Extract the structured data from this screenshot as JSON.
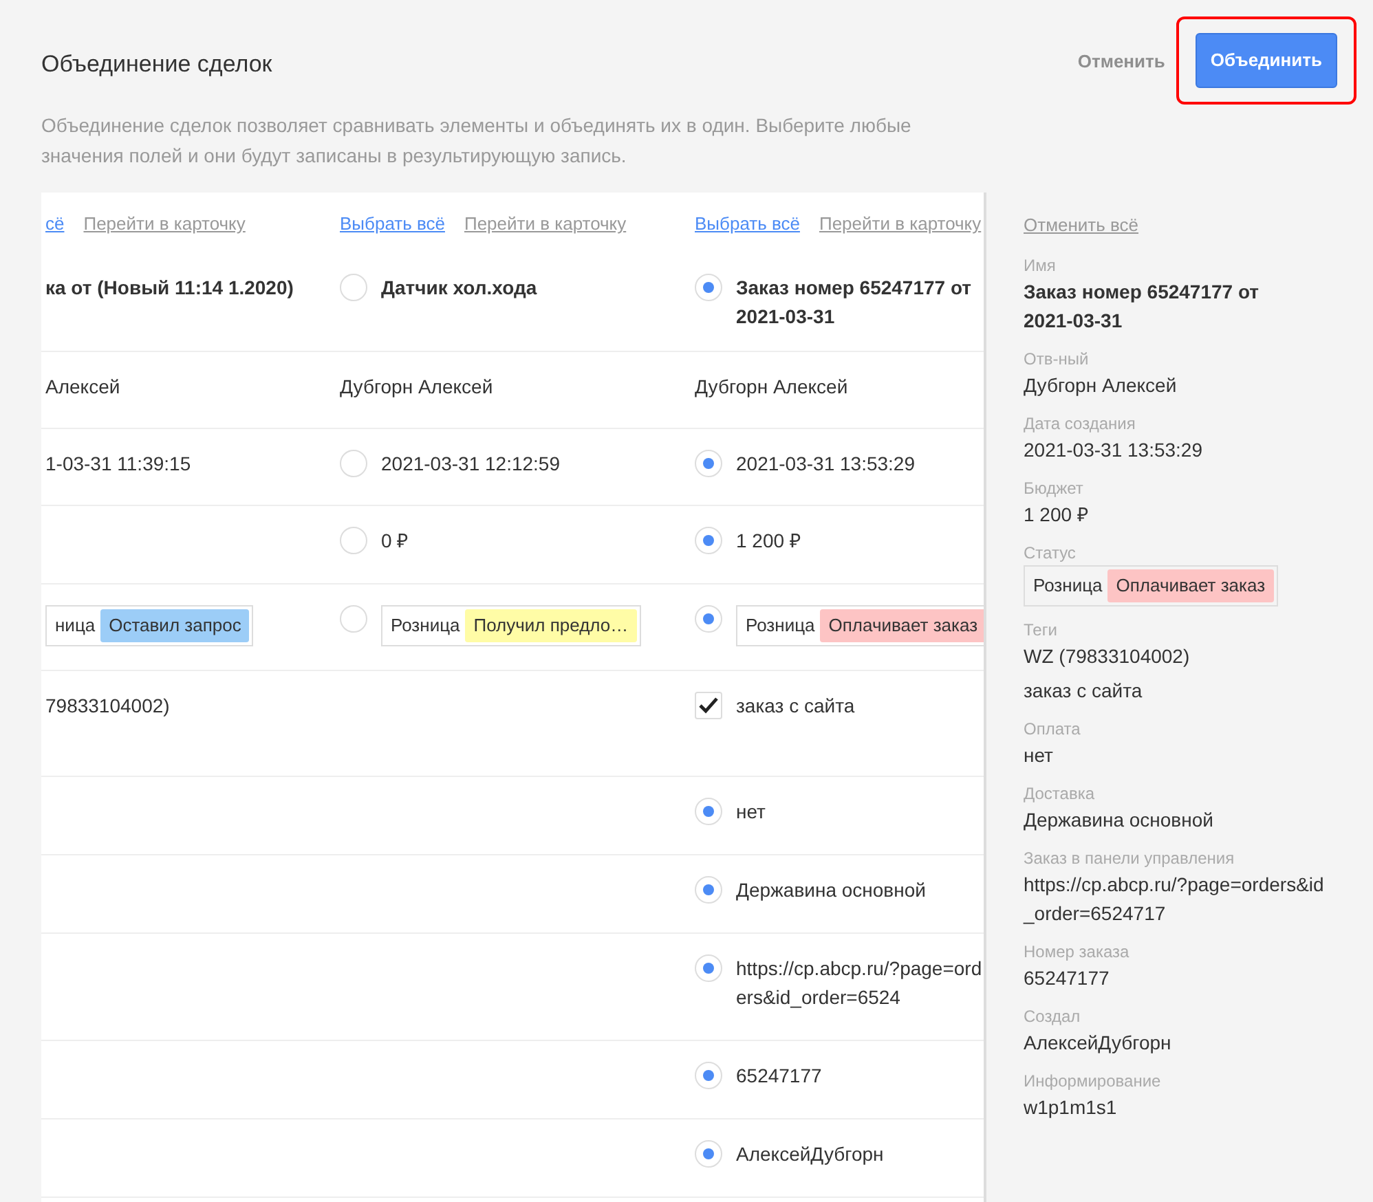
{
  "header": {
    "title": "Объединение сделок",
    "description": "Объединение сделок позволяет сравнивать элементы и объединять их в один. Выберите любые значения полей и они будут записаны в результирующую запись.",
    "cancel_button": "Отменить",
    "merge_button": "Объединить",
    "merge_highlighted": true
  },
  "columns": [
    {
      "select_all": "сё",
      "open_card": "Перейти в карточку",
      "cells": [
        {
          "kind": "title",
          "text": "ка от (Новый 11:14 1.2020)"
        },
        {
          "kind": "plain",
          "text": "Алексей"
        },
        {
          "kind": "plain",
          "text": "1-03-31 11:39:15"
        },
        {
          "kind": "empty"
        },
        {
          "kind": "status",
          "pipeline": "ница",
          "stage": "Оставил запрос",
          "color": "#9ccdf7"
        },
        {
          "kind": "plain",
          "text": "79833104002)"
        },
        {
          "kind": "empty"
        },
        {
          "kind": "empty"
        },
        {
          "kind": "empty"
        },
        {
          "kind": "empty"
        },
        {
          "kind": "empty"
        }
      ]
    },
    {
      "select_all": "Выбрать всё",
      "open_card": "Перейти в карточку",
      "cells": [
        {
          "kind": "radio_title",
          "text": "Датчик хол.хода",
          "selected": false
        },
        {
          "kind": "plain",
          "text": "Дубгорн Алексей"
        },
        {
          "kind": "radio",
          "text": "2021-03-31 12:12:59",
          "selected": false
        },
        {
          "kind": "radio",
          "text": "0 ₽",
          "selected": false
        },
        {
          "kind": "radio_status",
          "pipeline": "Розница",
          "stage": "Получил предло…",
          "color": "#fffca6",
          "selected": false
        },
        {
          "kind": "empty"
        },
        {
          "kind": "empty"
        },
        {
          "kind": "empty"
        },
        {
          "kind": "empty"
        },
        {
          "kind": "empty"
        },
        {
          "kind": "empty"
        }
      ]
    },
    {
      "select_all": "Выбрать всё",
      "open_card": "Перейти в карточку",
      "cells": [
        {
          "kind": "radio_title",
          "text": "Заказ номер 65247177 от 2021-03-31",
          "selected": true
        },
        {
          "kind": "plain",
          "text": "Дубгорн Алексей"
        },
        {
          "kind": "radio",
          "text": "2021-03-31 13:53:29",
          "selected": true
        },
        {
          "kind": "radio",
          "text": "1 200 ₽",
          "selected": true
        },
        {
          "kind": "radio_status",
          "pipeline": "Розница",
          "stage": "Оплачивает заказ",
          "color": "#fdc4c4",
          "selected": true
        },
        {
          "kind": "checkbox",
          "text": "заказ с сайта",
          "checked": true
        },
        {
          "kind": "radio",
          "text": "нет",
          "selected": true
        },
        {
          "kind": "radio",
          "text": "Державина основной",
          "selected": true
        },
        {
          "kind": "radio",
          "text": "https://cp.abcp.ru/?page=orders&id_order=6524",
          "selected": true
        },
        {
          "kind": "radio",
          "text": "65247177",
          "selected": true
        },
        {
          "kind": "radio",
          "text": "АлексейДубгорн",
          "selected": true
        }
      ]
    }
  ],
  "result": {
    "cancel_all": "Отменить всё",
    "fields": [
      {
        "label": "Имя",
        "kind": "title",
        "values": [
          "Заказ номер 65247177 от 2021-03-31"
        ]
      },
      {
        "label": "Отв-ный",
        "kind": "plain",
        "values": [
          "Дубгорн Алексей"
        ]
      },
      {
        "label": "Дата создания",
        "kind": "plain",
        "values": [
          "2021-03-31 13:53:29"
        ]
      },
      {
        "label": "Бюджет",
        "kind": "plain",
        "values": [
          "1 200 ₽"
        ]
      },
      {
        "label": "Статус",
        "kind": "status",
        "pipeline": "Розница",
        "stage": "Оплачивает заказ",
        "color": "#fdc4c4"
      },
      {
        "label": "Теги",
        "kind": "plain",
        "values": [
          "WZ (79833104002)",
          "заказ с сайта"
        ]
      },
      {
        "label": "Оплата",
        "kind": "plain",
        "values": [
          "нет"
        ]
      },
      {
        "label": "Доставка",
        "kind": "plain",
        "values": [
          "Державина основной"
        ]
      },
      {
        "label": "Заказ в панели управления",
        "kind": "plain",
        "values": [
          "https://cp.abcp.ru/?page=orders&id_order=6524717"
        ]
      },
      {
        "label": "Номер заказа",
        "kind": "plain",
        "values": [
          "65247177"
        ]
      },
      {
        "label": "Создал",
        "kind": "plain",
        "values": [
          "АлексейДубгорн"
        ]
      },
      {
        "label": "Информирование",
        "kind": "plain",
        "values": [
          "w1p1m1s1"
        ]
      }
    ]
  }
}
